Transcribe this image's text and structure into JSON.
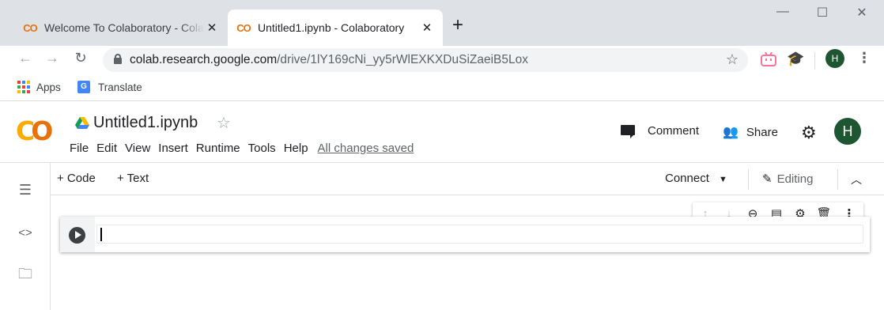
{
  "browser": {
    "tabs": [
      {
        "title": "Welcome To Colaboratory - Colaboratory",
        "active": false,
        "favicon": "colab-logo-icon"
      },
      {
        "title": "Untitled1.ipynb - Colaboratory",
        "active": true,
        "favicon": "colab-logo-icon"
      }
    ],
    "favicon_text": "CO",
    "new_tab": "+",
    "close_glyph": "✕",
    "url_host": "colab.research.google.com",
    "url_path": "/drive/1lY169cNi_yy5rWlEXKXDuSiZaeiB5Lox",
    "profile_initial": "H"
  },
  "bookmarks": [
    {
      "label": "Apps",
      "icon": "apps-grid-icon"
    },
    {
      "label": "Translate",
      "icon": "google-translate-icon"
    }
  ],
  "colab": {
    "logo_text": [
      "C",
      "O"
    ],
    "notebook_title": "Untitled1.ipynb",
    "menu": [
      "File",
      "Edit",
      "View",
      "Insert",
      "Runtime",
      "Tools",
      "Help"
    ],
    "save_status": "All changes saved",
    "comment_label": "Comment",
    "share_label": "Share",
    "user_initial": "H",
    "toolbar": {
      "add_code": "+ Code",
      "add_text": "+ Text",
      "connect": "Connect",
      "editing": "Editing"
    },
    "cell": {
      "content": ""
    }
  },
  "colors": {
    "colab_orange": "#e8710a",
    "colab_yellow": "#f9ab00",
    "avatar_green": "#1e5631",
    "tabstrip": "#dee1e6"
  }
}
